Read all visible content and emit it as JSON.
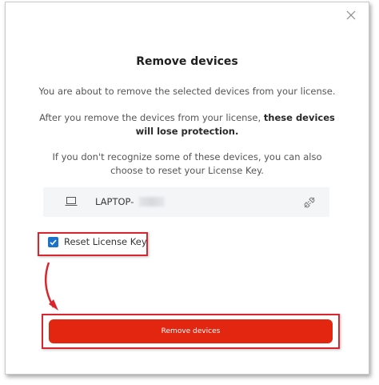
{
  "dialog": {
    "title": "Remove devices",
    "paragraph1": "You are about to remove the selected devices from your license.",
    "paragraph2_prefix": "After you remove the devices from your license, ",
    "paragraph2_bold": "these devices will lose protection.",
    "paragraph3": "If you don't recognize some of these devices, you can also choose to reset your License Key.",
    "device": {
      "name": "LAPTOP-",
      "icon": "laptop-icon",
      "action_icon": "unlink-icon"
    },
    "checkbox": {
      "label": "Reset License Key",
      "checked": true
    },
    "remove_button_label": "Remove devices",
    "close_icon": "close-icon"
  },
  "colors": {
    "accent_button": "#e3260f",
    "highlight": "#d9262e",
    "checkbox": "#1a73c9"
  }
}
